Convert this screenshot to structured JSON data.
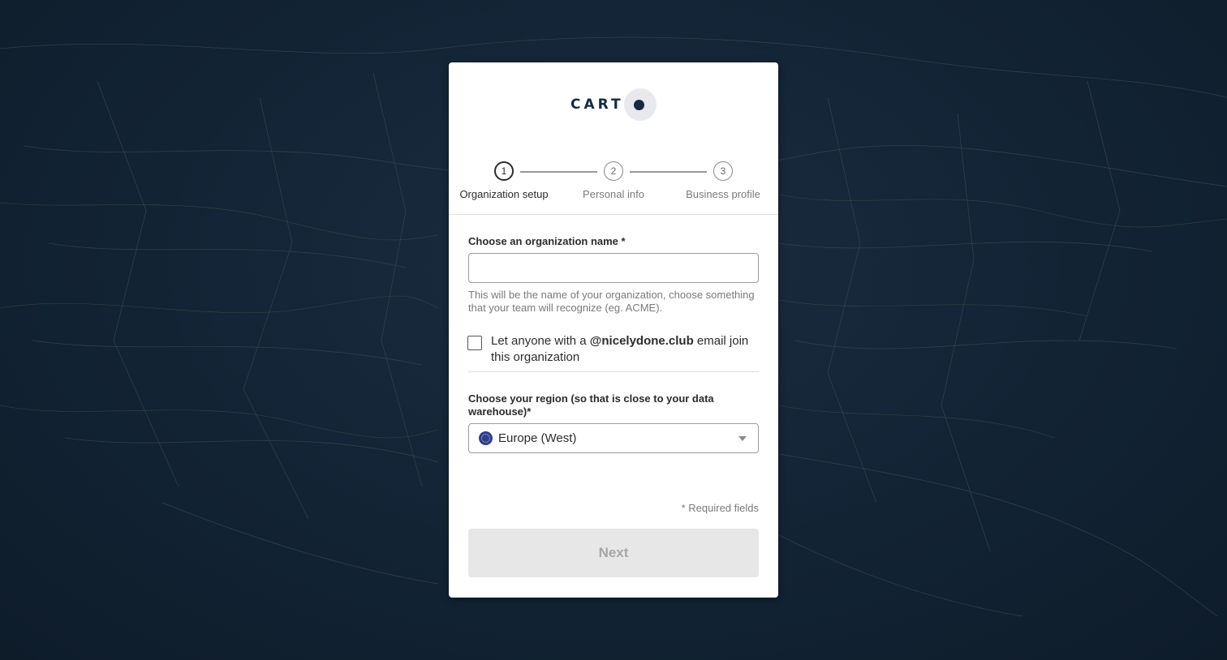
{
  "brand": {
    "logo_text": "CART"
  },
  "stepper": {
    "steps": [
      {
        "number": "1",
        "label": "Organization setup"
      },
      {
        "number": "2",
        "label": "Personal info"
      },
      {
        "number": "3",
        "label": "Business profile"
      }
    ]
  },
  "form": {
    "org_name": {
      "label": "Choose an organization name *",
      "value": "",
      "helper": "This will be the name of your organization, choose something that your team will recognize (eg. ACME)."
    },
    "domain_checkbox": {
      "prefix": "Let anyone with a ",
      "domain": "@nicelydone.club",
      "suffix": " email join this organization",
      "checked": false
    },
    "region": {
      "label": "Choose your region (so that is close to your data warehouse)*",
      "selected": "Europe (West)"
    },
    "required_note": "* Required fields",
    "next_label": "Next"
  },
  "colors": {
    "background": "#10202f",
    "brand_navy": "#162945",
    "button_disabled": "#e7e7e7"
  },
  "icons": {
    "region_flag": "eu-flag-icon",
    "dropdown": "chevron-down-icon",
    "logo_mark": "carto-dot-icon"
  }
}
